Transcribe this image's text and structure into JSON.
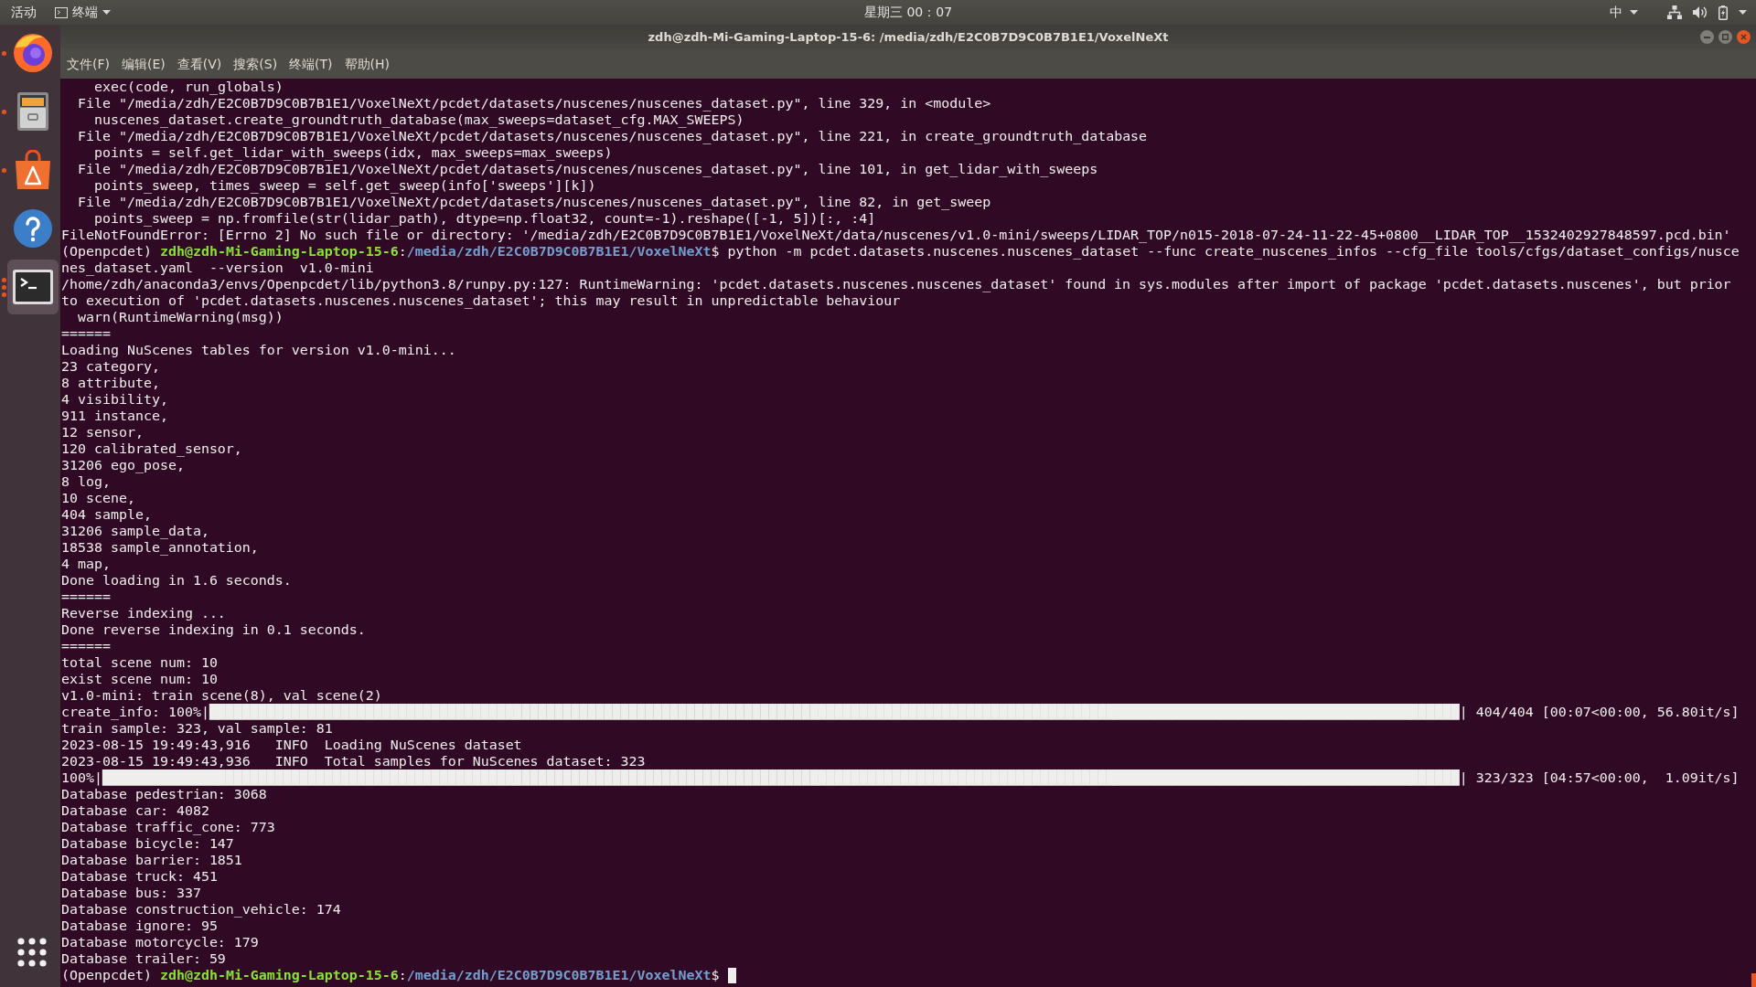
{
  "top_bar": {
    "activities": "活动",
    "app_menu": "终端",
    "clock": "星期三 00：07",
    "input_method": "中"
  },
  "dock": {
    "items": [
      {
        "kind": "browser",
        "windows": [
          {
            "open": true
          }
        ],
        "selected": false
      },
      {
        "kind": "files",
        "windows": [
          {
            "open": true
          }
        ],
        "selected": false
      },
      {
        "kind": "software",
        "windows": [
          {
            "open": true
          }
        ],
        "selected": false
      },
      {
        "kind": "help",
        "selected": false
      },
      {
        "kind": "terminal",
        "windows": [
          {
            "open": true
          },
          {
            "open": true
          },
          {
            "open": true
          }
        ],
        "selected": true
      }
    ]
  },
  "window": {
    "title": "zdh@zdh-Mi-Gaming-Laptop-15-6: /media/zdh/E2C0B7D9C0B7B1E1/VoxelNeXt",
    "menu": [
      "文件(F)",
      "编辑(E)",
      "查看(V)",
      "搜索(S)",
      "终端(T)",
      "帮助(H)"
    ]
  },
  "terminal": {
    "lines": [
      {
        "kind": "text",
        "text": "    exec(code, run_globals)"
      },
      {
        "kind": "text",
        "text": "  File \"/media/zdh/E2C0B7D9C0B7B1E1/VoxelNeXt/pcdet/datasets/nuscenes/nuscenes_dataset.py\", line 329, in <module>"
      },
      {
        "kind": "text",
        "text": "    nuscenes_dataset.create_groundtruth_database(max_sweeps=dataset_cfg.MAX_SWEEPS)"
      },
      {
        "kind": "text",
        "text": "  File \"/media/zdh/E2C0B7D9C0B7B1E1/VoxelNeXt/pcdet/datasets/nuscenes/nuscenes_dataset.py\", line 221, in create_groundtruth_database"
      },
      {
        "kind": "text",
        "text": "    points = self.get_lidar_with_sweeps(idx, max_sweeps=max_sweeps)"
      },
      {
        "kind": "text",
        "text": "  File \"/media/zdh/E2C0B7D9C0B7B1E1/VoxelNeXt/pcdet/datasets/nuscenes/nuscenes_dataset.py\", line 101, in get_lidar_with_sweeps"
      },
      {
        "kind": "text",
        "text": "    points_sweep, times_sweep = self.get_sweep(info['sweeps'][k])"
      },
      {
        "kind": "text",
        "text": "  File \"/media/zdh/E2C0B7D9C0B7B1E1/VoxelNeXt/pcdet/datasets/nuscenes/nuscenes_dataset.py\", line 82, in get_sweep"
      },
      {
        "kind": "text",
        "text": "    points_sweep = np.fromfile(str(lidar_path), dtype=np.float32, count=-1).reshape([-1, 5])[:, :4]"
      },
      {
        "kind": "text",
        "text": "FileNotFoundError: [Errno 2] No such file or directory: '/media/zdh/E2C0B7D9C0B7B1E1/VoxelNeXt/data/nuscenes/v1.0-mini/sweeps/LIDAR_TOP/n015-2018-07-24-11-22-45+0800__LIDAR_TOP__1532402927848597.pcd.bin'"
      },
      {
        "kind": "prompt",
        "env": "(Openpcdet)",
        "user_host": "zdh@zdh-Mi-Gaming-Laptop-15-6",
        "separator": ":",
        "path": "/media/zdh/E2C0B7D9C0B7B1E1/VoxelNeXt",
        "symbol": "$",
        "command": "python -m pcdet.datasets.nuscenes.nuscenes_dataset --func create_nuscenes_infos --cfg_file tools/cfgs/dataset_configs/nusce"
      },
      {
        "kind": "text",
        "text": "nes_dataset.yaml  --version  v1.0-mini"
      },
      {
        "kind": "text",
        "text": "/home/zdh/anaconda3/envs/Openpcdet/lib/python3.8/runpy.py:127: RuntimeWarning: 'pcdet.datasets.nuscenes.nuscenes_dataset' found in sys.modules after import of package 'pcdet.datasets.nuscenes', but prior"
      },
      {
        "kind": "text",
        "text": "to execution of 'pcdet.datasets.nuscenes.nuscenes_dataset'; this may result in unpredictable behaviour"
      },
      {
        "kind": "text",
        "text": "  warn(RuntimeWarning(msg))"
      },
      {
        "kind": "text",
        "text": "======"
      },
      {
        "kind": "text",
        "text": "Loading NuScenes tables for version v1.0-mini..."
      },
      {
        "kind": "text",
        "text": "23 category,"
      },
      {
        "kind": "text",
        "text": "8 attribute,"
      },
      {
        "kind": "text",
        "text": "4 visibility,"
      },
      {
        "kind": "text",
        "text": "911 instance,"
      },
      {
        "kind": "text",
        "text": "12 sensor,"
      },
      {
        "kind": "text",
        "text": "120 calibrated_sensor,"
      },
      {
        "kind": "text",
        "text": "31206 ego_pose,"
      },
      {
        "kind": "text",
        "text": "8 log,"
      },
      {
        "kind": "text",
        "text": "10 scene,"
      },
      {
        "kind": "text",
        "text": "404 sample,"
      },
      {
        "kind": "text",
        "text": "31206 sample_data,"
      },
      {
        "kind": "text",
        "text": "18538 sample_annotation,"
      },
      {
        "kind": "text",
        "text": "4 map,"
      },
      {
        "kind": "text",
        "text": "Done loading in 1.6 seconds."
      },
      {
        "kind": "text",
        "text": "======"
      },
      {
        "kind": "text",
        "text": "Reverse indexing ..."
      },
      {
        "kind": "text",
        "text": "Done reverse indexing in 0.1 seconds."
      },
      {
        "kind": "text",
        "text": "======"
      },
      {
        "kind": "text",
        "text": "total scene num: 10"
      },
      {
        "kind": "text",
        "text": "exist scene num: 10"
      },
      {
        "kind": "text",
        "text": "v1.0-mini: train scene(8), val scene(2)"
      },
      {
        "kind": "text",
        "text": "create_info: 100%|████████████████████████████████████████████████████████████████████████████████████████████████████████████████████████████████████████████████████████| 404/404 [00:07<00:00, 56.80it/s]"
      },
      {
        "kind": "text",
        "text": "train sample: 323, val sample: 81"
      },
      {
        "kind": "text",
        "text": "2023-08-15 19:49:43,916   INFO  Loading NuScenes dataset"
      },
      {
        "kind": "text",
        "text": "2023-08-15 19:49:43,936   INFO  Total samples for NuScenes dataset: 323"
      },
      {
        "kind": "text",
        "text": "100%|█████████████████████████████████████████████████████████████████████████████████████████████████████████████████████████████████████████████████████████████████████| 323/323 [04:57<00:00,  1.09it/s]"
      },
      {
        "kind": "text",
        "text": "Database pedestrian: 3068"
      },
      {
        "kind": "text",
        "text": "Database car: 4082"
      },
      {
        "kind": "text",
        "text": "Database traffic_cone: 773"
      },
      {
        "kind": "text",
        "text": "Database bicycle: 147"
      },
      {
        "kind": "text",
        "text": "Database barrier: 1851"
      },
      {
        "kind": "text",
        "text": "Database truck: 451"
      },
      {
        "kind": "text",
        "text": "Database bus: 337"
      },
      {
        "kind": "text",
        "text": "Database construction_vehicle: 174"
      },
      {
        "kind": "text",
        "text": "Database ignore: 95"
      },
      {
        "kind": "text",
        "text": "Database motorcycle: 179"
      },
      {
        "kind": "text",
        "text": "Database trailer: 59"
      },
      {
        "kind": "prompt",
        "env": "(Openpcdet)",
        "user_host": "zdh@zdh-Mi-Gaming-Laptop-15-6",
        "separator": ":",
        "path": "/media/zdh/E2C0B7D9C0B7B1E1/VoxelNeXt",
        "symbol": "$",
        "cursor": true
      }
    ]
  }
}
